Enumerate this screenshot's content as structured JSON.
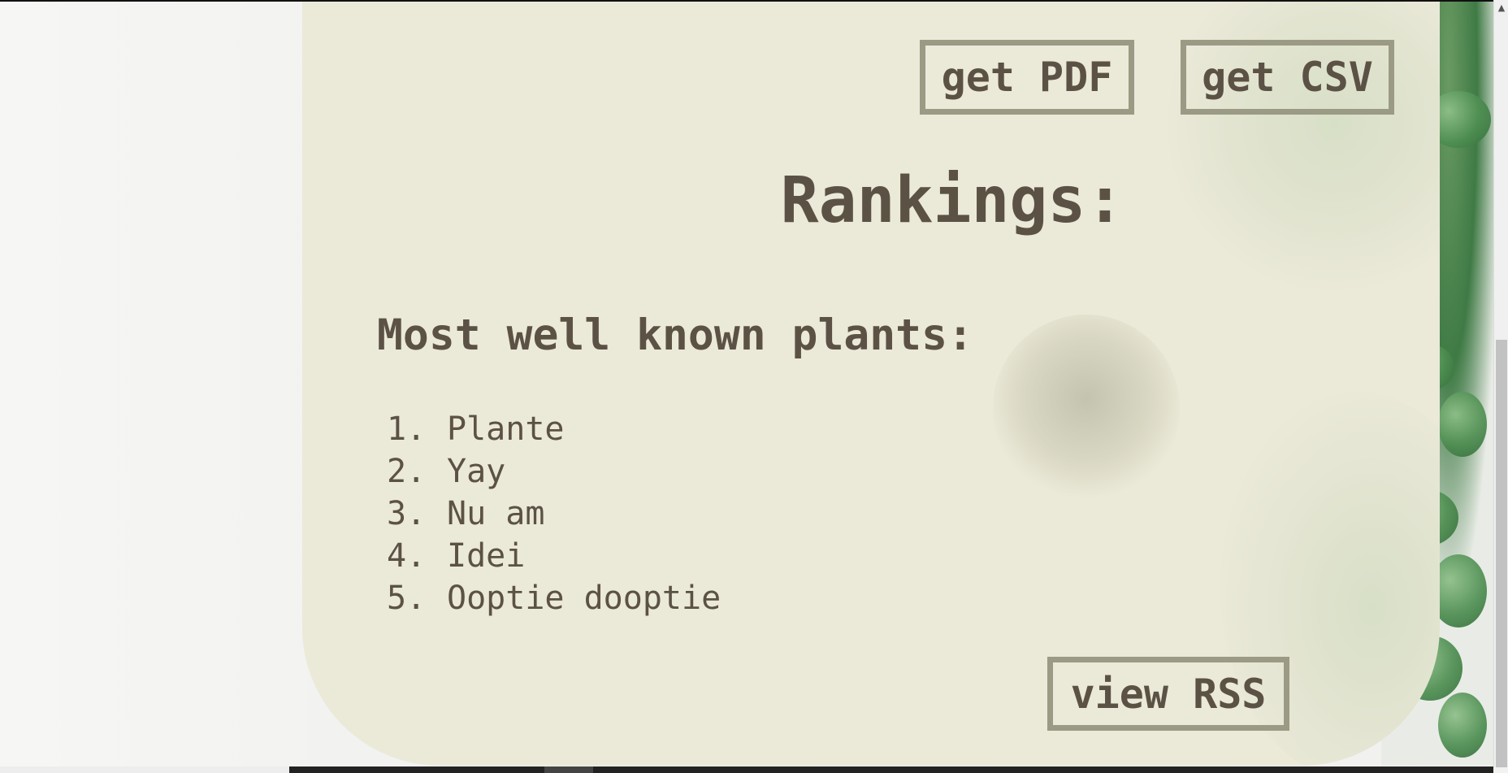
{
  "toolbar": {
    "pdf_label": "get PDF",
    "csv_label": "get CSV",
    "rss_label": "view RSS"
  },
  "main": {
    "title": "Rankings:",
    "section_title": "Most well known plants:",
    "rankings": [
      {
        "rank": "1.",
        "name": "Plante"
      },
      {
        "rank": "2.",
        "name": "Yay"
      },
      {
        "rank": "3.",
        "name": "Nu am"
      },
      {
        "rank": "4.",
        "name": "Idei"
      },
      {
        "rank": "5.",
        "name": "Ooptie dooptie"
      }
    ]
  },
  "scrollbar": {
    "up_arrow_icon": "chevron-up-icon"
  },
  "colors": {
    "card_background": "#ebe9d8",
    "text": "#5b5245",
    "button_border": "#9b9a85"
  }
}
